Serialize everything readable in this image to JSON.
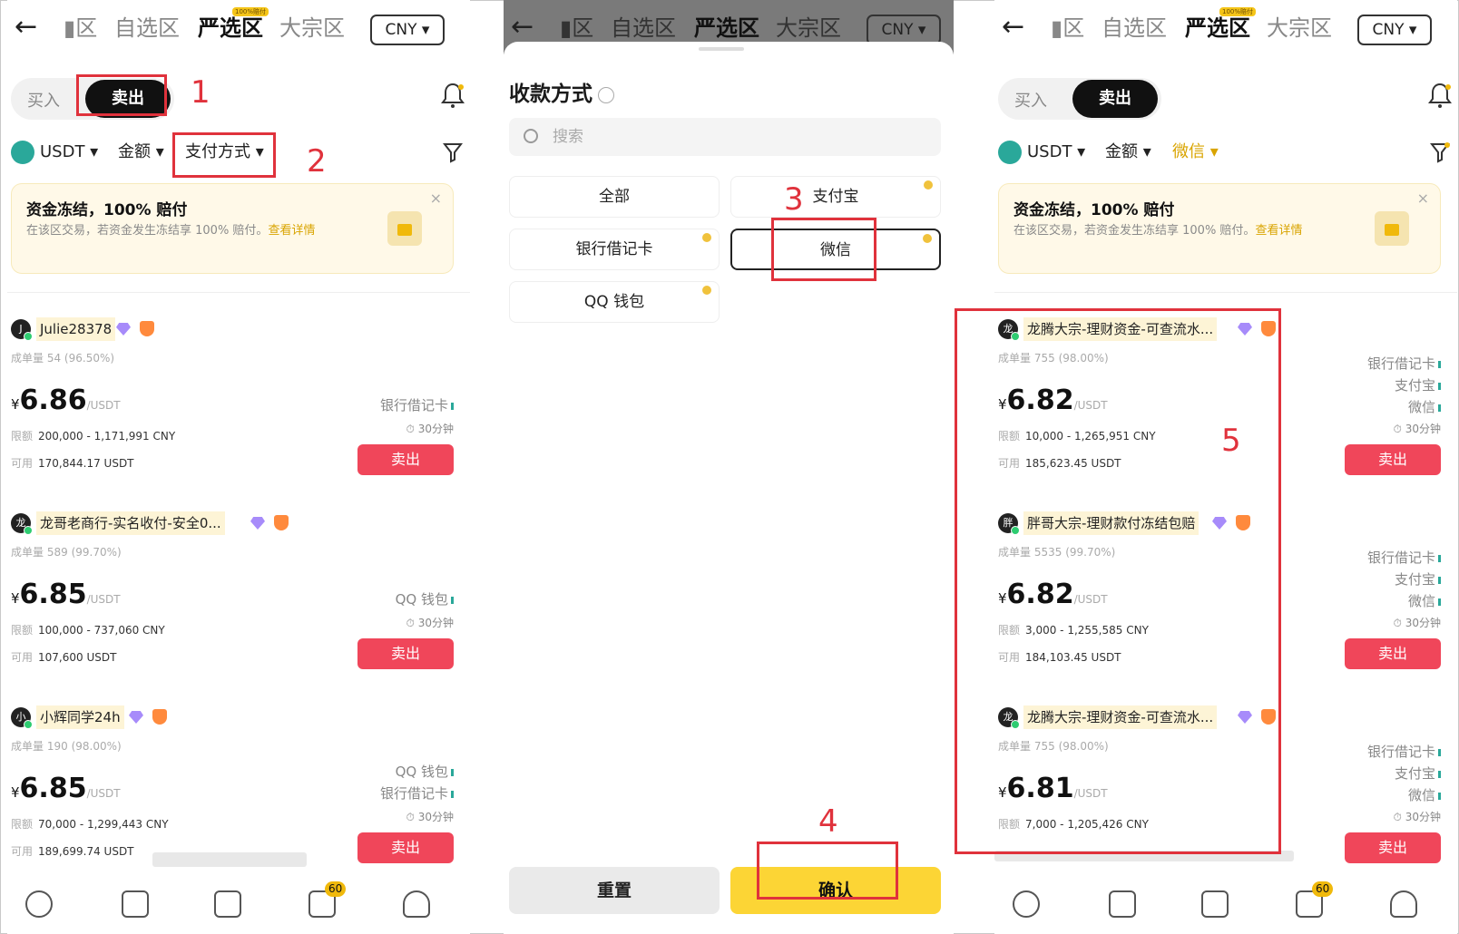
{
  "nav": {
    "back": "←",
    "tabs": [
      "▮区",
      "自选区",
      "严选区",
      "大宗区"
    ],
    "hot_tag": "100%赔付",
    "currency": "CNY ▾"
  },
  "toggle": {
    "buy": "买入",
    "sell": "卖出"
  },
  "filters": {
    "coin": "USDT ▾",
    "amount": "金额 ▾",
    "payment": "支付方式 ▾",
    "payment_selected": "微信 ▾"
  },
  "banner": {
    "title": "资金冻结，100% 赔付",
    "desc": "在该区交易，若资金发生冻结享 100% 赔付。",
    "link": "查看详情",
    "close": "×"
  },
  "labels": {
    "count": "成单量",
    "limit": "限额",
    "avail": "可用",
    "currency_sign": "¥",
    "unit": "/USDT",
    "sell": "卖出",
    "time": "⏱ 30分钟"
  },
  "left_ads": [
    {
      "avatar": "J",
      "name": "Julie28378",
      "count": "54 (96.50%)",
      "price": "6.86",
      "limit": "200,000 - 1,171,991 CNY",
      "avail": "170,844.17 USDT",
      "methods": [
        "银行借记卡"
      ]
    },
    {
      "avatar": "龙",
      "name": "龙哥老商行-实名收付-安全0...",
      "count": "589 (99.70%)",
      "price": "6.85",
      "limit": "100,000 - 737,060 CNY",
      "avail": "107,600 USDT",
      "methods": [
        "QQ 钱包"
      ]
    },
    {
      "avatar": "小",
      "name": "小辉同学24h",
      "count": "190 (98.00%)",
      "price": "6.85",
      "limit": "70,000 - 1,299,443 CNY",
      "avail": "189,699.74 USDT",
      "methods": [
        "QQ 钱包",
        "银行借记卡"
      ]
    }
  ],
  "right_ads": [
    {
      "avatar": "龙",
      "name": "龙腾大宗-理财资金-可查流水...",
      "count": "755 (98.00%)",
      "price": "6.82",
      "limit": "10,000 - 1,265,951 CNY",
      "avail": "185,623.45 USDT",
      "methods": [
        "银行借记卡",
        "支付宝",
        "微信"
      ]
    },
    {
      "avatar": "胖",
      "name": "胖哥大宗-理财款付冻结包赔",
      "count": "5535 (99.70%)",
      "price": "6.82",
      "limit": "3,000 - 1,255,585 CNY",
      "avail": "184,103.45 USDT",
      "methods": [
        "银行借记卡",
        "支付宝",
        "微信"
      ]
    },
    {
      "avatar": "龙",
      "name": "龙腾大宗-理财资金-可查流水...",
      "count": "755 (98.00%)",
      "price": "6.81",
      "limit": "7,000 - 1,205,426 CNY",
      "avail": "",
      "methods": [
        "银行借记卡",
        "支付宝",
        "微信"
      ]
    }
  ],
  "sheet": {
    "title": "收款方式",
    "search_placeholder": "搜索",
    "options": [
      "全部",
      "支付宝",
      "银行借记卡",
      "微信",
      "QQ 钱包"
    ],
    "reset": "重置",
    "confirm": "确认"
  },
  "bottom_nav": {
    "badge": "60"
  },
  "steps": [
    "1",
    "2",
    "3",
    "4",
    "5"
  ],
  "colors": {
    "accent": "#fcd535",
    "sell": "#f0465a",
    "annotation": "#e0323c"
  }
}
